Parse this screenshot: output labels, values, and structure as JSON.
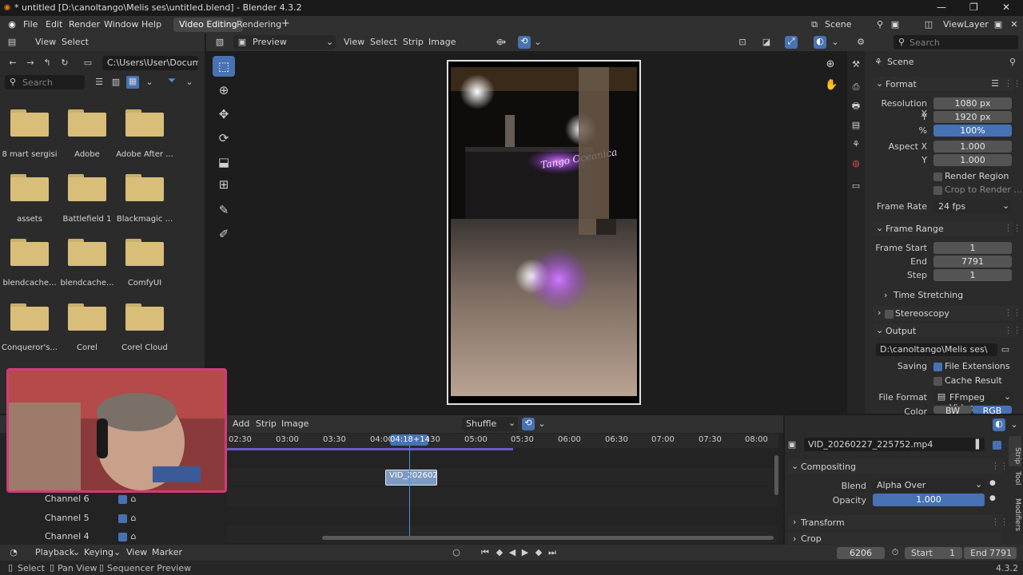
{
  "titlebar": {
    "title": "* untitled [D:\\canoltango\\Melis ses\\untitled.blend] - Blender 4.3.2",
    "minimize": "—",
    "maximize": "❐",
    "close": "✕"
  },
  "menu": {
    "file": "File",
    "edit": "Edit",
    "render": "Render",
    "window": "Window",
    "help": "Help"
  },
  "workspaces": {
    "video_editing": "Video Editing",
    "rendering": "Rendering",
    "add": "+"
  },
  "scene_selector": {
    "scene": "Scene",
    "viewlayer": "ViewLayer"
  },
  "file_browser": {
    "header_view": "View",
    "header_select": "Select",
    "path": "C:\\Users\\User\\Docume...",
    "search_placeholder": "Search",
    "folders": [
      "8 mart sergisi",
      "Adobe",
      "Adobe After ...",
      "assets",
      "Battlefield 1",
      "Blackmagic ...",
      "blendcache...",
      "blendcache...",
      "ComfyUI",
      "Conqueror's...",
      "Corel",
      "Corel Cloud"
    ]
  },
  "preview": {
    "mode": "Preview",
    "menu_view": "View",
    "menu_select": "Select",
    "menu_strip": "Strip",
    "menu_image": "Image",
    "neon_text": "Tango Oceanica"
  },
  "properties": {
    "search_placeholder": "Search",
    "context": "Scene",
    "format_header": "Format",
    "resolution_x_label": "Resolution X",
    "resolution_x": "1080 px",
    "resolution_y_label": "Y",
    "resolution_y": "1920 px",
    "resolution_pct_label": "%",
    "resolution_pct": "100%",
    "aspect_x_label": "Aspect X",
    "aspect_x": "1.000",
    "aspect_y_label": "Y",
    "aspect_y": "1.000",
    "render_region": "Render Region",
    "crop_to_render": "Crop to Render ...",
    "frame_rate_label": "Frame Rate",
    "frame_rate": "24 fps",
    "frame_range_header": "Frame Range",
    "frame_start_label": "Frame Start",
    "frame_start": "1",
    "end_label": "End",
    "end": "7791",
    "step_label": "Step",
    "step": "1",
    "time_stretching": "Time Stretching",
    "stereoscopy": "Stereoscopy",
    "output_header": "Output",
    "output_path": "D:\\canoltango\\Melis ses\\",
    "saving_label": "Saving",
    "file_extensions": "File Extensions",
    "cache_result": "Cache Result",
    "file_format_label": "File Format",
    "file_format": "FFmpeg Video",
    "color_label": "Color",
    "color_bw": "BW",
    "color_rgb": "RGB"
  },
  "sequencer": {
    "menu_add": "Add",
    "menu_strip": "Strip",
    "menu_image": "Image",
    "overlap_mode": "Shuffle",
    "playhead_label": "04:18+14",
    "ticks": [
      "02:30",
      "03:00",
      "03:30",
      "04:00",
      "04:30",
      "05:00",
      "05:30",
      "06:00",
      "06:30",
      "07:00",
      "07:30",
      "08:00"
    ],
    "strip_label": "VID_202602",
    "channels": [
      "Channel 6",
      "Channel 5",
      "Channel 4"
    ]
  },
  "strip_props": {
    "strip_name": "VID_20260227_225752.mp4",
    "compositing_header": "Compositing",
    "blend_label": "Blend",
    "blend_mode": "Alpha Over",
    "opacity_label": "Opacity",
    "opacity": "1.000",
    "transform_header": "Transform",
    "crop_header": "Crop",
    "tab_strip": "Strip",
    "tab_tool": "Tool",
    "tab_modifiers": "Modifiers"
  },
  "timeline": {
    "playback": "Playback",
    "keying": "Keying",
    "view": "View",
    "marker": "Marker",
    "current_frame": "6206",
    "start_label": "Start",
    "start": "1",
    "end_label": "End",
    "end": "7791"
  },
  "statusbar": {
    "select": "Select",
    "pan_view": "Pan View",
    "sequencer_preview": "Sequencer Preview",
    "version": "4.3.2"
  }
}
